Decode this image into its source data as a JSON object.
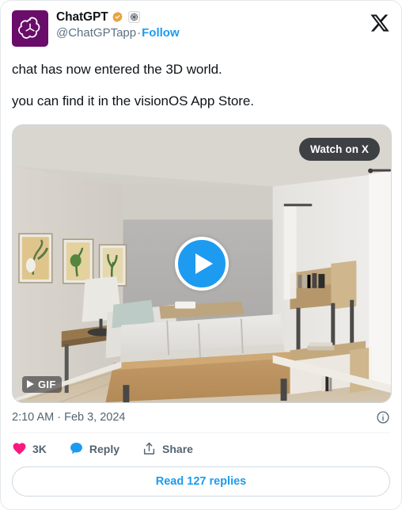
{
  "card": {
    "border_color": "#e4e8eb",
    "background": "#ffffff"
  },
  "header": {
    "display_name": "ChatGPT",
    "verified_badge": "verified-gold-badge",
    "affiliate_badge": "openai-affiliate-badge",
    "handle": "@ChatGPTapp",
    "separator": "·",
    "follow_label": "Follow",
    "brand_logo": "x-logo",
    "avatar": {
      "icon": "openai-logo",
      "background": "#6A0D6A"
    }
  },
  "body": {
    "paragraphs": [
      "chat has now entered the 3D world.",
      "you can find it in the visionOS App Store."
    ]
  },
  "media": {
    "type": "gif-video",
    "alt": "3D rendered living room interior with sofa, wooden coffee table, shelving unit and framed botanical prints",
    "watch_on_x_label": "Watch on X",
    "gif_badge_label": "GIF",
    "play_button": "play-icon",
    "accent_color": "#1d9bf0"
  },
  "meta": {
    "timestamp": "2:10 AM · Feb 3, 2024",
    "info_icon": "info-circle-icon"
  },
  "actions": [
    {
      "icon": "heart-icon",
      "label": "3K",
      "color": "#f91880"
    },
    {
      "icon": "reply-bubble-icon",
      "label": "Reply",
      "color": "#1d9bf0"
    },
    {
      "icon": "share-icon",
      "label": "Share",
      "color": "#536471"
    }
  ],
  "footer": {
    "read_replies_label": "Read 127 replies",
    "link_color": "#1d9bf0"
  }
}
